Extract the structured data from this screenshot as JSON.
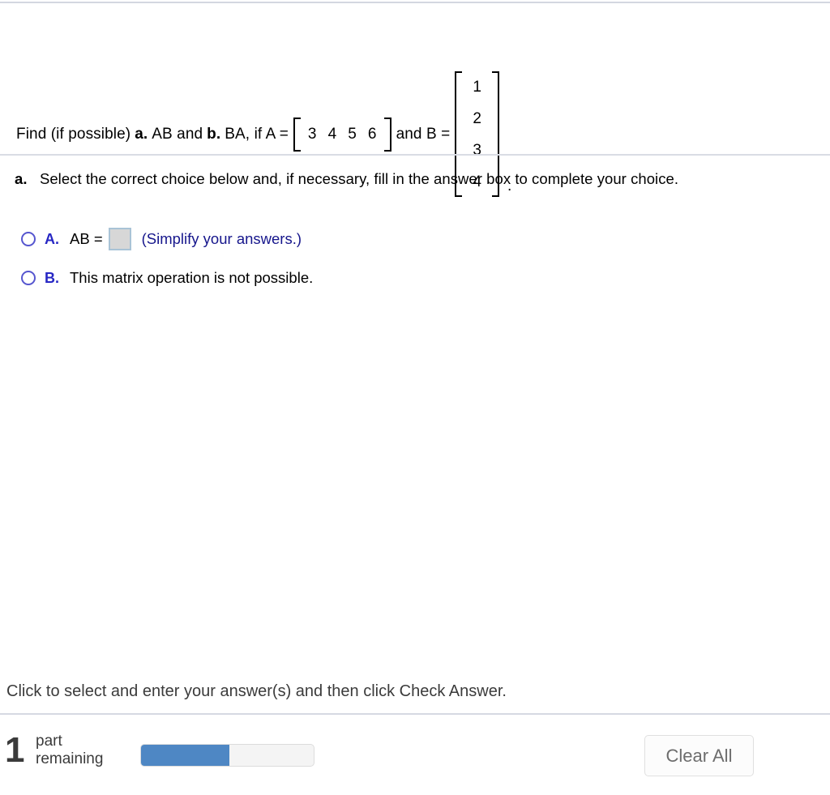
{
  "question": {
    "prefix": "Find (if possible)",
    "part_a_label": "a.",
    "part_a_expr": "AB and",
    "part_b_label": "b.",
    "part_b_expr": "BA, if A =",
    "matrix_a": {
      "name": "A",
      "rows": 1,
      "cols": 4,
      "values": [
        "3",
        "4",
        "5",
        "6"
      ]
    },
    "connector": "and B =",
    "matrix_b": {
      "name": "B",
      "rows": 4,
      "cols": 1,
      "values": [
        "1",
        "2",
        "3",
        "4"
      ]
    },
    "terminator": "."
  },
  "answer_section": {
    "part_label": "a.",
    "prompt": "Select the correct choice below and, if necessary, fill in the answer box to complete your choice.",
    "choices": [
      {
        "letter": "A.",
        "prefix": "AB =",
        "has_input": true,
        "input_value": "",
        "input_placeholder": "",
        "hint": "(Simplify your answers.)",
        "selected": false
      },
      {
        "letter": "B.",
        "prefix": "This matrix operation is not possible.",
        "has_input": false,
        "hint": "",
        "selected": false
      }
    ]
  },
  "footer": {
    "instruction": "Click to select and enter your answer(s) and then click Check Answer."
  },
  "status_bar": {
    "parts_remaining_count": "1",
    "parts_label_line1": "part",
    "parts_label_line2": "remaining",
    "progress_percent": 51,
    "clear_all_label": "Clear All"
  },
  "colors": {
    "choice_letter": "#2727c4",
    "radio_outline": "#5656cf",
    "hint_text": "#16168c",
    "progress_fill": "#4e87c4",
    "answer_box_fill": "#d7d7d7",
    "answer_box_border": "#a9c3d6",
    "divider": "#d6d9e2"
  }
}
